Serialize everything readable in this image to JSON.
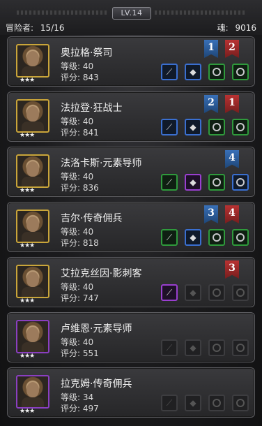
{
  "header": {
    "level_badge": "LV.14",
    "adventurers_label": "冒险者:",
    "adventurers_value": "15/16",
    "soul_label": "魂:",
    "soul_value": "9016"
  },
  "heroes": [
    {
      "name": "奥拉格·祭司",
      "level": "等级: 40",
      "score": "评分: 843",
      "stars": "★★★",
      "flags": [
        {
          "n": "1",
          "c": "blue"
        },
        {
          "n": "2",
          "c": "red"
        }
      ],
      "slots": [
        "blue",
        "blue",
        "green",
        "green"
      ]
    },
    {
      "name": "法拉登·狂战士",
      "level": "等级: 40",
      "score": "评分: 841",
      "stars": "★★★",
      "flags": [
        {
          "n": "2",
          "c": "blue"
        },
        {
          "n": "1",
          "c": "red"
        }
      ],
      "slots": [
        "blue",
        "blue",
        "green",
        "green"
      ]
    },
    {
      "name": "法洛卡斯·元素导师",
      "level": "等级: 40",
      "score": "评分: 836",
      "stars": "★★★",
      "flags": [
        {
          "n": "4",
          "c": "blue"
        }
      ],
      "slots": [
        "green",
        "purple",
        "green",
        "blue"
      ]
    },
    {
      "name": "吉尔·传奇佣兵",
      "level": "等级: 40",
      "score": "评分: 818",
      "stars": "★★★",
      "flags": [
        {
          "n": "3",
          "c": "blue"
        },
        {
          "n": "4",
          "c": "red"
        }
      ],
      "slots": [
        "green",
        "blue",
        "green",
        "green"
      ]
    },
    {
      "name": "艾拉克丝因·影刺客",
      "level": "等级: 40",
      "score": "评分: 747",
      "stars": "★★★",
      "flags": [
        {
          "n": "3",
          "c": "red"
        }
      ],
      "slots": [
        "purple",
        "empty",
        "empty",
        "empty"
      ]
    },
    {
      "name": "卢维恩·元素导师",
      "level": "等级: 40",
      "score": "评分: 551",
      "stars": "★★★",
      "flags": [],
      "slots": [
        "empty",
        "empty",
        "empty",
        "empty"
      ]
    },
    {
      "name": "拉克姆·传奇佣兵",
      "level": "等级: 34",
      "score": "评分: 497",
      "stars": "★★★",
      "flags": [],
      "slots": [
        "empty",
        "empty",
        "empty",
        "empty"
      ]
    }
  ],
  "portrait_frames": [
    "gold",
    "gold",
    "gold",
    "gold",
    "gold",
    "purple",
    "purple"
  ],
  "slot_icons": [
    "wand-icon",
    "gem-icon",
    "ring-icon",
    "ring-icon"
  ]
}
